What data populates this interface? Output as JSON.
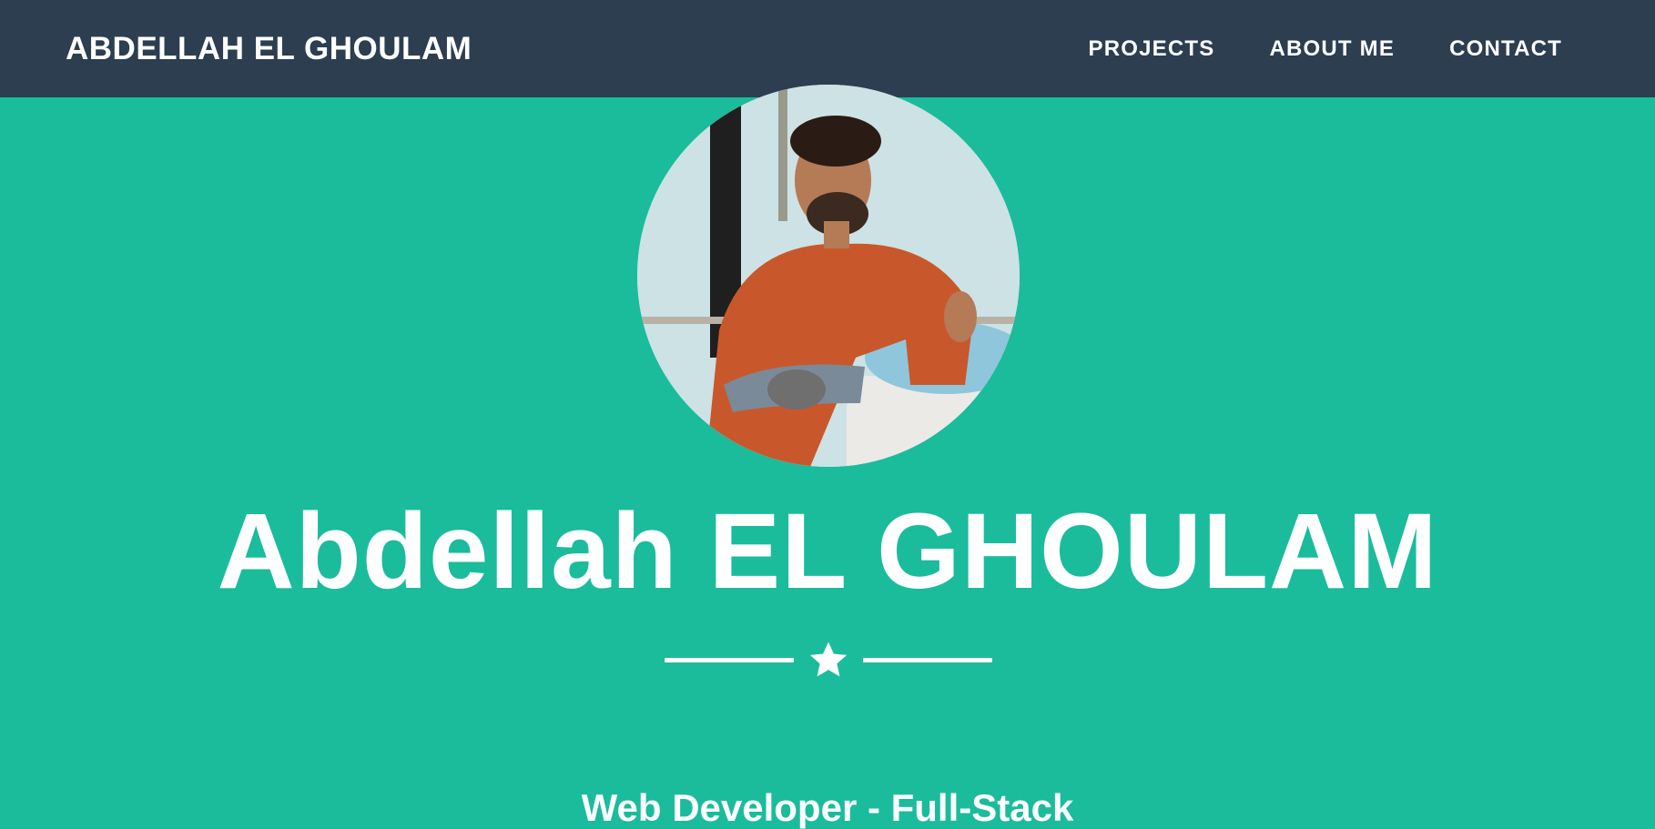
{
  "navbar": {
    "brand": "ABDELLAH EL GHOULAM",
    "links": [
      {
        "label": "PROJECTS"
      },
      {
        "label": "ABOUT ME"
      },
      {
        "label": "CONTACT"
      }
    ]
  },
  "masthead": {
    "avatar_icon": "profile-photo",
    "heading": "Abdellah EL GHOULAM",
    "divider_icon": "star-icon",
    "subheading": "Web Developer - Full-Stack"
  },
  "colors": {
    "navbar_bg": "#2c3e50",
    "masthead_bg": "#1abc9c",
    "text": "#ffffff"
  }
}
